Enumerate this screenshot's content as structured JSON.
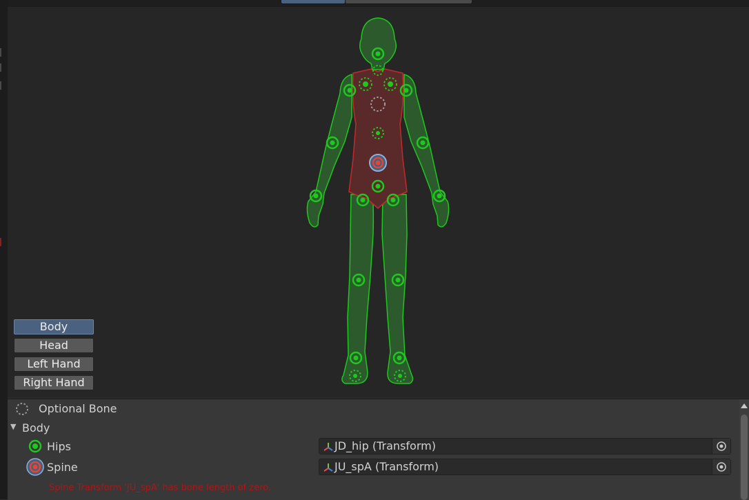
{
  "body_parts": {
    "items": [
      {
        "label": "Body",
        "active": true
      },
      {
        "label": "Head",
        "active": false
      },
      {
        "label": "Left Hand",
        "active": false
      },
      {
        "label": "Right Hand",
        "active": false
      }
    ]
  },
  "legend": {
    "optional_bone_label": "Optional Bone"
  },
  "inspector": {
    "section_title": "Body",
    "bones": [
      {
        "name": "Hips",
        "status": "ok",
        "value": "JD_hip (Transform)"
      },
      {
        "name": "Spine",
        "status": "error",
        "value": "JU_spA (Transform)"
      }
    ],
    "error_message": "Spine Transform 'JU_spA' has bone length of zero."
  },
  "colors": {
    "bone_ok": "#1ec81e",
    "bone_error": "#e0473a",
    "body_fill_ok": "#2c5a2c",
    "body_fill_error": "#5a2a2a",
    "active_button": "#4a6180",
    "error_text": "#b11414"
  }
}
